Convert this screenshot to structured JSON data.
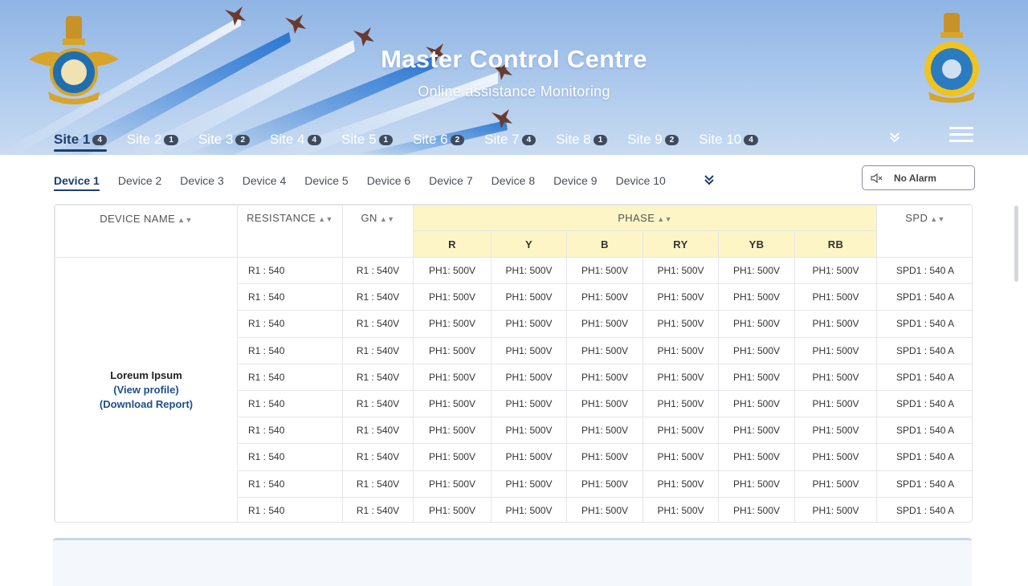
{
  "header": {
    "title": "Master Control Centre",
    "subtitle": "Online assistance Monitoring",
    "left_emblem_icon": "air-force-emblem-icon",
    "right_emblem_icon": "command-crest-icon"
  },
  "site_tabs": [
    {
      "label": "Site 1",
      "badge": "4",
      "active": true
    },
    {
      "label": "Site 2",
      "badge": "1"
    },
    {
      "label": "Site 3",
      "badge": "2"
    },
    {
      "label": "Site 4",
      "badge": "4"
    },
    {
      "label": "Site 5",
      "badge": "1"
    },
    {
      "label": "Site 6",
      "badge": "2"
    },
    {
      "label": "Site 7",
      "badge": "4"
    },
    {
      "label": "Site 8",
      "badge": "1"
    },
    {
      "label": "Site 9",
      "badge": "2"
    },
    {
      "label": "Site 10",
      "badge": "4"
    }
  ],
  "device_tabs": [
    "Device 1",
    "Device 2",
    "Device 3",
    "Device 4",
    "Device 5",
    "Device 6",
    "Device 7",
    "Device 8",
    "Device 9",
    "Device 10"
  ],
  "active_device_index": 0,
  "alarm": {
    "label": "No Alarm",
    "icon": "speaker-muted-icon"
  },
  "table": {
    "columns": {
      "device_name": "DEVICE NAME",
      "resistance": "RESISTANCE",
      "gn": "GN",
      "phase": "PHASE",
      "spd": "SPD"
    },
    "phase_columns": [
      "R",
      "Y",
      "B",
      "RY",
      "YB",
      "RB"
    ],
    "device": {
      "name": "Loreum Ipsum",
      "view_profile": "(View profile)",
      "download_report": "(Download Report)"
    },
    "rows": [
      {
        "resistance": "R1 : 540",
        "gn": "R1 : 540V",
        "phases": [
          "PH1: 500V",
          "PH1: 500V",
          "PH1: 500V",
          "PH1: 500V",
          "PH1: 500V",
          "PH1: 500V"
        ],
        "spd": "SPD1 : 540 A"
      },
      {
        "resistance": "R1 : 540",
        "gn": "R1 : 540V",
        "phases": [
          "PH1: 500V",
          "PH1: 500V",
          "PH1: 500V",
          "PH1: 500V",
          "PH1: 500V",
          "PH1: 500V"
        ],
        "spd": "SPD1 : 540 A"
      },
      {
        "resistance": "R1 : 540",
        "gn": "R1 : 540V",
        "phases": [
          "PH1: 500V",
          "PH1: 500V",
          "PH1: 500V",
          "PH1: 500V",
          "PH1: 500V",
          "PH1: 500V"
        ],
        "spd": "SPD1 : 540 A"
      },
      {
        "resistance": "R1 : 540",
        "gn": "R1 : 540V",
        "phases": [
          "PH1: 500V",
          "PH1: 500V",
          "PH1: 500V",
          "PH1: 500V",
          "PH1: 500V",
          "PH1: 500V"
        ],
        "spd": "SPD1 : 540 A"
      },
      {
        "resistance": "R1 : 540",
        "gn": "R1 : 540V",
        "phases": [
          "PH1: 500V",
          "PH1: 500V",
          "PH1: 500V",
          "PH1: 500V",
          "PH1: 500V",
          "PH1: 500V"
        ],
        "spd": "SPD1 : 540 A"
      },
      {
        "resistance": "R1 : 540",
        "gn": "R1 : 540V",
        "phases": [
          "PH1: 500V",
          "PH1: 500V",
          "PH1: 500V",
          "PH1: 500V",
          "PH1: 500V",
          "PH1: 500V"
        ],
        "spd": "SPD1 : 540 A"
      },
      {
        "resistance": "R1 : 540",
        "gn": "R1 : 540V",
        "phases": [
          "PH1: 500V",
          "PH1: 500V",
          "PH1: 500V",
          "PH1: 500V",
          "PH1: 500V",
          "PH1: 500V"
        ],
        "spd": "SPD1 : 540 A"
      },
      {
        "resistance": "R1 : 540",
        "gn": "R1 : 540V",
        "phases": [
          "PH1: 500V",
          "PH1: 500V",
          "PH1: 500V",
          "PH1: 500V",
          "PH1: 500V",
          "PH1: 500V"
        ],
        "spd": "SPD1 : 540 A"
      },
      {
        "resistance": "R1 : 540",
        "gn": "R1 : 540V",
        "phases": [
          "PH1: 500V",
          "PH1: 500V",
          "PH1: 500V",
          "PH1: 500V",
          "PH1: 500V",
          "PH1: 500V"
        ],
        "spd": "SPD1 : 540 A"
      },
      {
        "resistance": "R1 : 540",
        "gn": "R1 : 540V",
        "phases": [
          "PH1: 500V",
          "PH1: 500V",
          "PH1: 500V",
          "PH1: 500V",
          "PH1: 500V",
          "PH1: 500V"
        ],
        "spd": "SPD1 : 540 A"
      }
    ]
  },
  "colors": {
    "accent": "#1c3d6e",
    "phase_header_bg": "#fdf5c6",
    "link": "#1f4f8b",
    "header_sky": "#a8c6ec"
  }
}
